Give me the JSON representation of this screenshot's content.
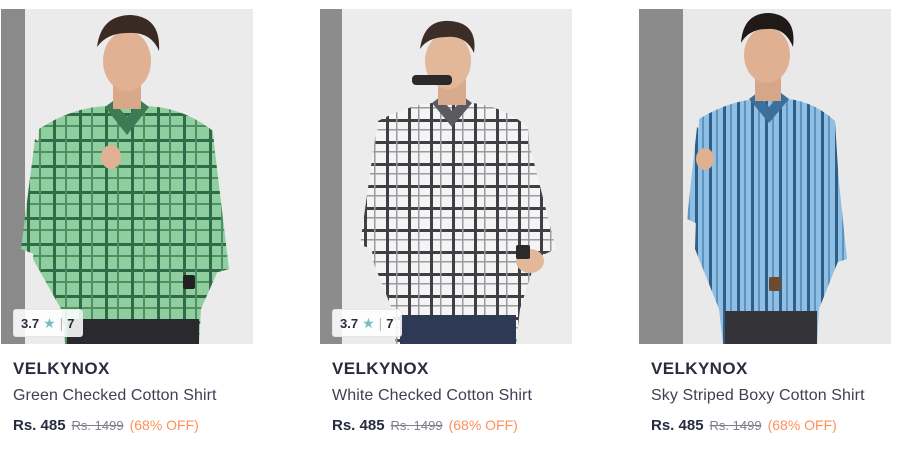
{
  "products": [
    {
      "brand": "VELKYNOX",
      "name": "Green Checked Cotton Shirt",
      "price": "Rs. 485",
      "mrp": "Rs. 1499",
      "discount": "(68% OFF)",
      "rating": "3.7",
      "rating_count": "7",
      "show_rating": true,
      "image_icon": "green-checked-shirt-model"
    },
    {
      "brand": "VELKYNOX",
      "name": "White Checked Cotton Shirt",
      "price": "Rs. 485",
      "mrp": "Rs. 1499",
      "discount": "(68% OFF)",
      "rating": "3.7",
      "rating_count": "7",
      "show_rating": true,
      "image_icon": "white-checked-shirt-model"
    },
    {
      "brand": "VELKYNOX",
      "name": "Sky Striped Boxy Cotton Shirt",
      "price": "Rs. 485",
      "mrp": "Rs. 1499",
      "discount": "(68% OFF)",
      "show_rating": false,
      "image_icon": "sky-striped-shirt-model"
    }
  ],
  "rating_separator": "|",
  "colors": {
    "brand_text": "#282c3f",
    "discount": "#ff905a",
    "star": "#72bfbc",
    "mrp": "#7e818c"
  }
}
